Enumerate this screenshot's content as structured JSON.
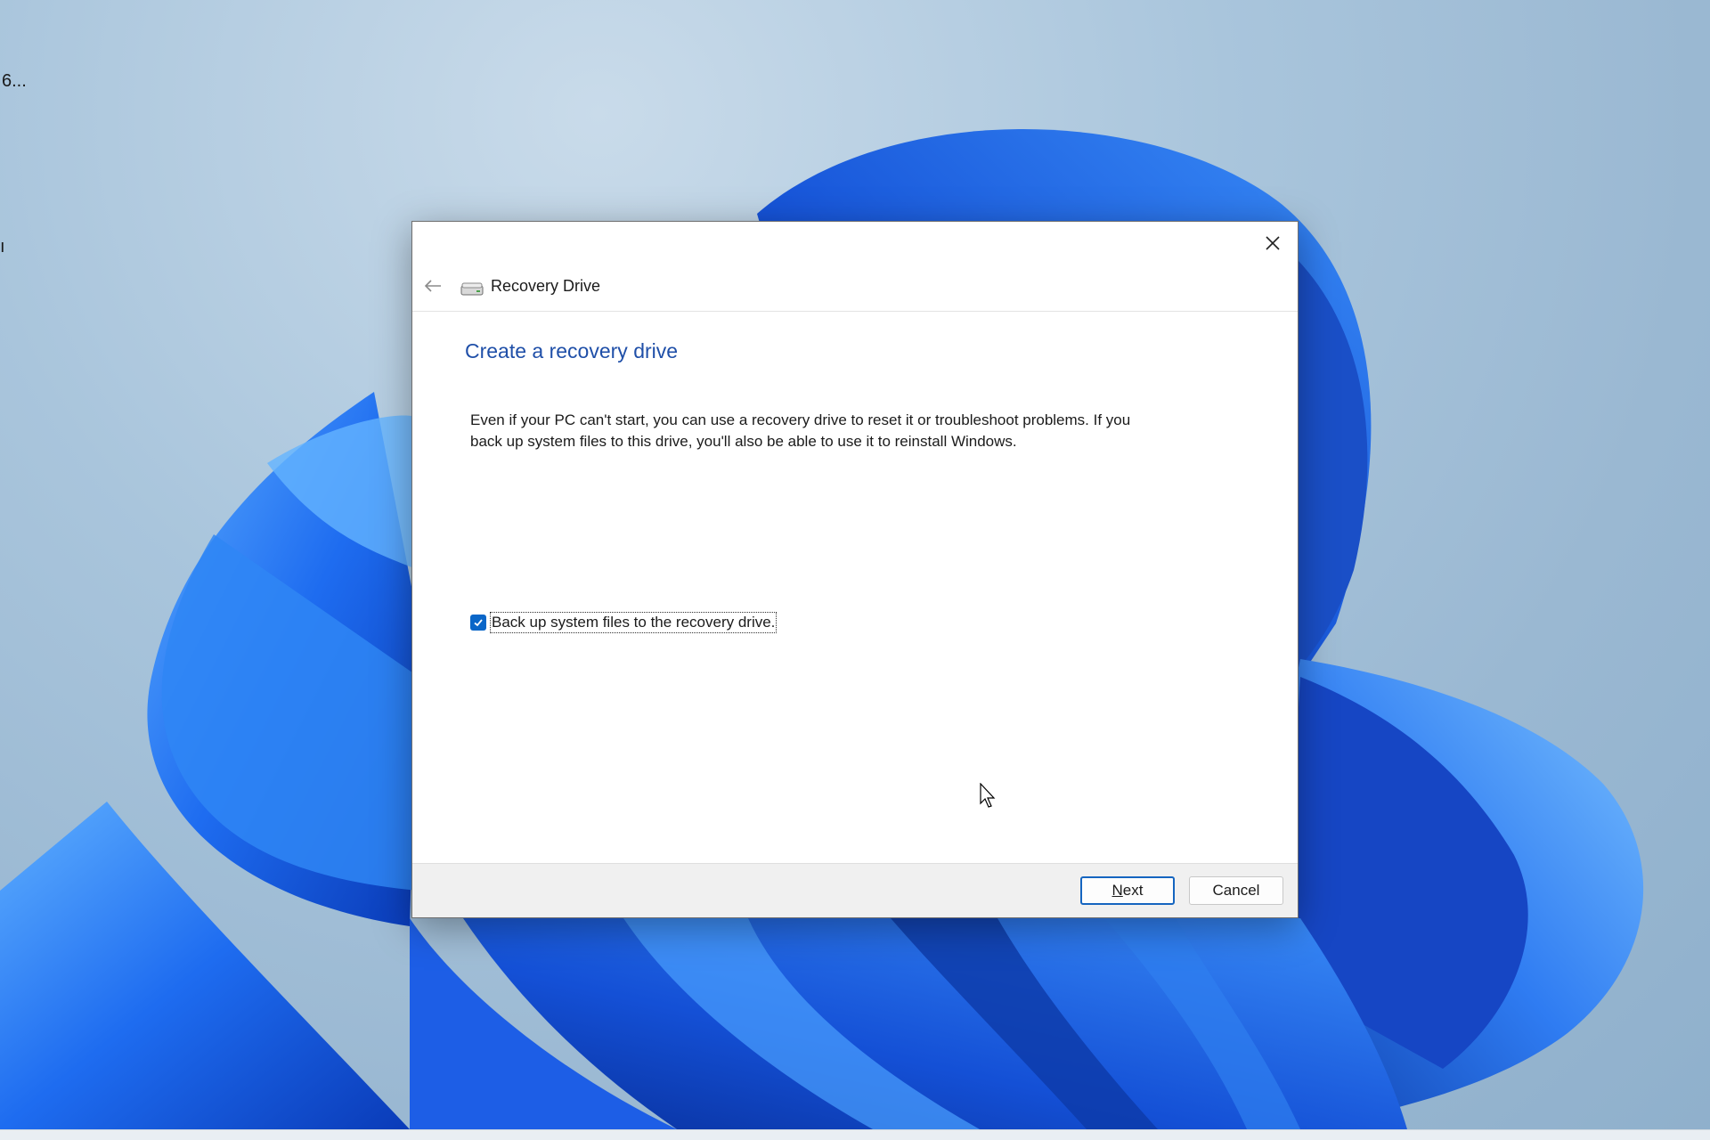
{
  "desktop": {
    "partial_label_top": "6...",
    "partial_label_mid": "ı"
  },
  "window": {
    "title": "Recovery Drive",
    "close_icon": "close-icon",
    "back_icon": "back-arrow-icon",
    "app_icon": "drive-icon"
  },
  "content": {
    "heading": "Create a recovery drive",
    "description": "Even if your PC can't start, you can use a recovery drive to reset it or troubleshoot problems. If you back up system files to this drive, you'll also be able to use it to reinstall Windows.",
    "backup_checkbox": {
      "label": "Back up system files to the recovery drive.",
      "checked": true
    }
  },
  "footer": {
    "next_mnemonic": "N",
    "next_rest": "ext",
    "cancel_label": "Cancel"
  },
  "colors": {
    "heading": "#1f4fa8",
    "checkbox": "#0a66c8",
    "wallpaper_blue": "#1a5fe0"
  }
}
